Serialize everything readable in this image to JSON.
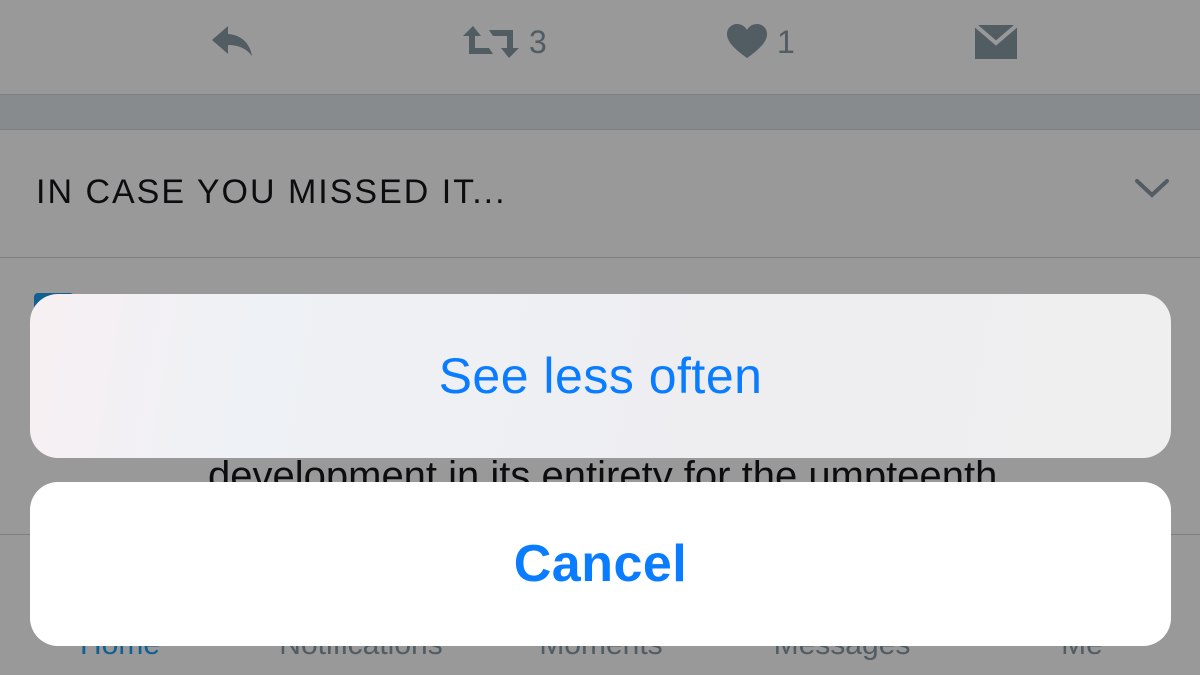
{
  "tweet_actions": {
    "reply_icon": "reply-icon",
    "retweet_icon": "retweet-icon",
    "retweet_count": "3",
    "like_icon": "heart-icon",
    "like_count": "1",
    "dm_icon": "envelope-icon"
  },
  "section": {
    "title": "IN CASE YOU MISSED IT...",
    "toggle_icon": "chevron-down-icon"
  },
  "feed_item": {
    "text": "development in its entirety for the umpteenth"
  },
  "tabbar": {
    "tabs": [
      {
        "label": "Home",
        "active": true
      },
      {
        "label": "Notifications",
        "active": false
      },
      {
        "label": "Moments",
        "active": false
      },
      {
        "label": "Messages",
        "active": false
      },
      {
        "label": "Me",
        "active": false
      }
    ]
  },
  "action_sheet": {
    "option_label": "See less often",
    "cancel_label": "Cancel"
  },
  "colors": {
    "accent": "#0a7cff",
    "twitter_blue": "#1da1f2",
    "icon_gray": "#8899a6"
  }
}
